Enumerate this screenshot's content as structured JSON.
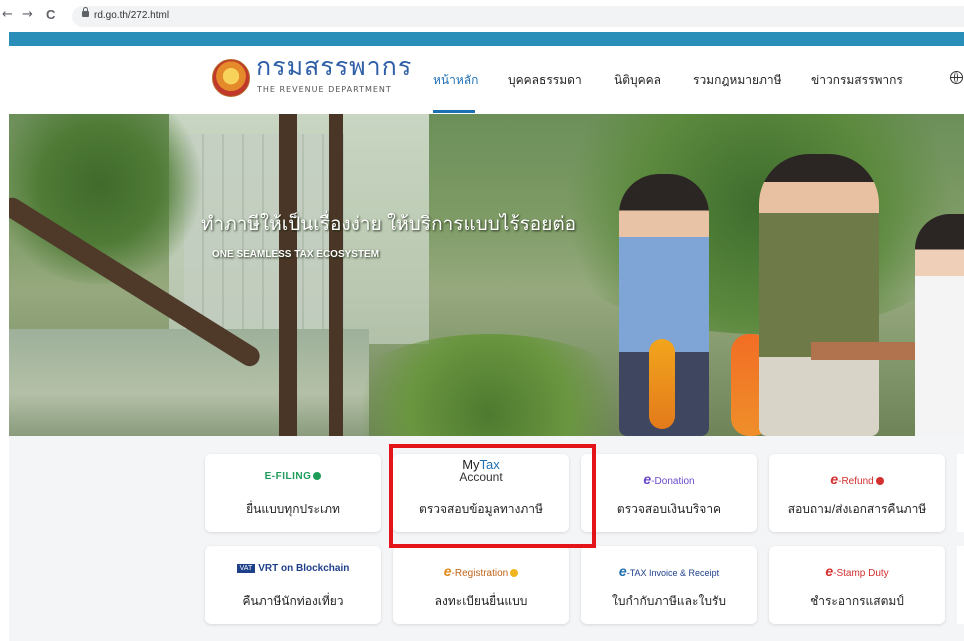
{
  "browser": {
    "back": "←",
    "forward": "→",
    "reload": "C",
    "url": "rd.go.th/272.html"
  },
  "header": {
    "logo_th": "กรมสรรพากร",
    "logo_en": "THE REVENUE DEPARTMENT",
    "nav": [
      {
        "label": "หน้าหลัก",
        "active": true
      },
      {
        "label": "บุคคลธรรมดา"
      },
      {
        "label": "นิติบุคคล"
      },
      {
        "label": "รวมกฎหมายภาษี"
      },
      {
        "label": "ข่าวกรมสรรพากร"
      }
    ]
  },
  "hero": {
    "title": "ทำภาษีให้เป็นเรื่องง่าย ให้บริการแบบไร้รอยต่อ",
    "subtitle": "ONE SEAMLESS TAX ECOSYSTEM"
  },
  "services": {
    "row1": [
      {
        "logo": "E-FILING",
        "label": "ยื่นแบบทุกประเภท"
      },
      {
        "logo_l1a": "My",
        "logo_l1b": "Tax",
        "logo_l2": "Account",
        "label": "ตรวจสอบข้อมูลทางภาษี"
      },
      {
        "logo_e": "e",
        "logo": "-Donation",
        "label": "ตรวจสอบเงินบริจาค"
      },
      {
        "logo_e": "e",
        "logo": "-Refund",
        "label": "สอบถาม/ส่งเอกสารคืนภาษี"
      }
    ],
    "row2": [
      {
        "logo_badge": "VAT",
        "logo": "VRT on Blockchain",
        "label": "คืนภาษีนักท่องเที่ยว"
      },
      {
        "logo_e": "e",
        "logo": "-Registration",
        "label": "ลงทะเบียนยื่นแบบ"
      },
      {
        "logo_e": "e",
        "logo": "-TAX Invoice & Receipt",
        "label": "ใบกำกับภาษีและใบรับ"
      },
      {
        "logo_e": "e",
        "logo": "-Stamp Duty",
        "label": "ชำระอากรแสตมป์"
      }
    ]
  },
  "colors": {
    "brand_blue": "#2f5fa6",
    "teal_band": "#2a8fb8",
    "highlight_red": "#e3141a"
  }
}
